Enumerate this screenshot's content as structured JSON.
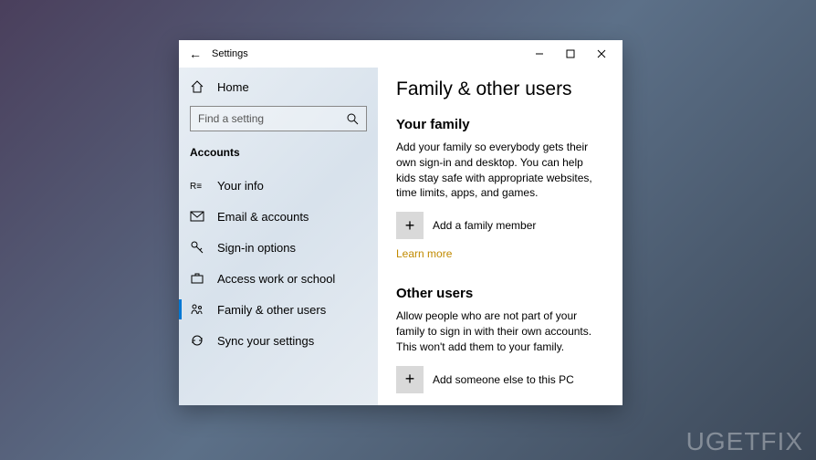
{
  "titlebar": {
    "title": "Settings"
  },
  "sidebar": {
    "home": "Home",
    "search_placeholder": "Find a setting",
    "section": "Accounts",
    "items": [
      {
        "label": "Your info"
      },
      {
        "label": "Email & accounts"
      },
      {
        "label": "Sign-in options"
      },
      {
        "label": "Access work or school"
      },
      {
        "label": "Family & other users"
      },
      {
        "label": "Sync your settings"
      }
    ]
  },
  "main": {
    "heading": "Family & other users",
    "family": {
      "title": "Your family",
      "desc": "Add your family so everybody gets their own sign-in and desktop. You can help kids stay safe with appropriate websites, time limits, apps, and games.",
      "add_label": "Add a family member",
      "learn_more": "Learn more"
    },
    "other": {
      "title": "Other users",
      "desc": "Allow people who are not part of your family to sign in with their own accounts. This won't add them to your family.",
      "add_label": "Add someone else to this PC"
    }
  },
  "watermark": "UGETFIX"
}
